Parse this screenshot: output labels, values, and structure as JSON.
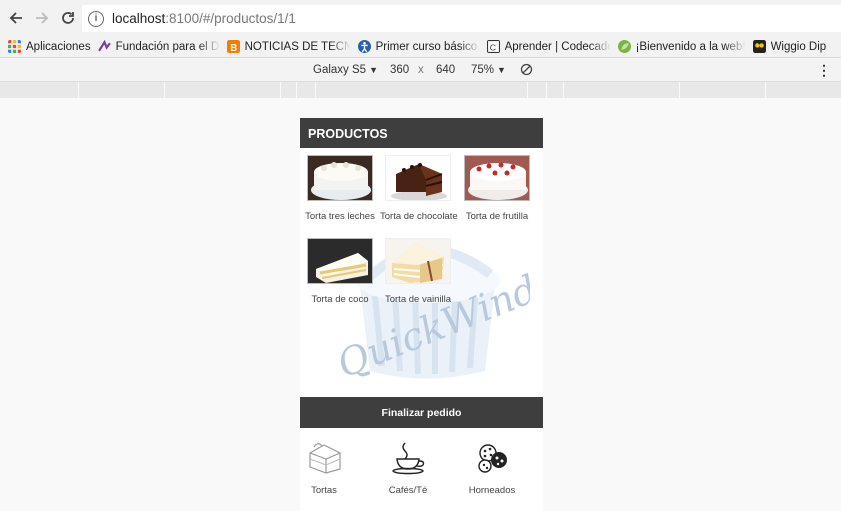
{
  "browser": {
    "url_host": "localhost",
    "url_path": ":8100/#/productos/1/1",
    "info_icon": "i"
  },
  "bookmarks": [
    {
      "label": "Aplicaciones",
      "icon": "apps-grid-icon"
    },
    {
      "label": "Fundación para el Des",
      "icon": "fundacion-icon"
    },
    {
      "label": "NOTICIAS DE TECNOL",
      "icon": "blogger-icon"
    },
    {
      "label": "Primer curso básico d",
      "icon": "accessibility-icon"
    },
    {
      "label": "Aprender | Codecade",
      "icon": "codecademy-icon"
    },
    {
      "label": "¡Bienvenido a la web!",
      "icon": "leaf-icon"
    },
    {
      "label": "Wiggio Dip",
      "icon": "wiggio-icon"
    }
  ],
  "device_toolbar": {
    "device": "Galaxy S5",
    "width": "360",
    "times": "x",
    "height": "640",
    "zoom": "75%"
  },
  "app": {
    "header_title": "PRODUCTOS",
    "products": [
      {
        "label": "Torta tres leches"
      },
      {
        "label": "Torta de chocolate"
      },
      {
        "label": "Torta de frutilla"
      },
      {
        "label": "Torta de coco"
      },
      {
        "label": "Torta de vainilla"
      }
    ],
    "finalize_label": "Finalizar pedido",
    "tabs": [
      {
        "label": "Tortas",
        "icon": "cake-slice-icon"
      },
      {
        "label": "Cafés/Té",
        "icon": "coffee-cup-icon"
      },
      {
        "label": "Horneados",
        "icon": "cookies-icon"
      }
    ],
    "watermark_text": "QuickWinder"
  }
}
